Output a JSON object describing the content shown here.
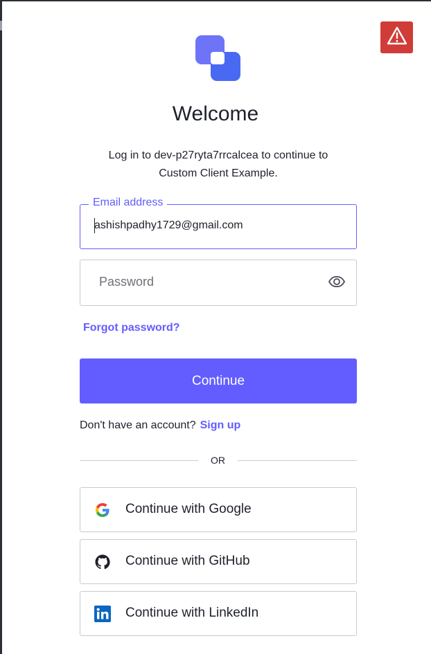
{
  "header": {
    "title": "Welcome",
    "subtitle_line1": "Log in to dev-p27ryta7rrcalcea to continue to",
    "subtitle_line2": "Custom Client Example."
  },
  "form": {
    "email": {
      "label": "Email address",
      "value": "ashishpadhy1729@gmail.com"
    },
    "password": {
      "placeholder": "Password",
      "value": ""
    },
    "forgot_password": "Forgot password?",
    "continue_label": "Continue"
  },
  "signup": {
    "prompt": "Don't have an account?",
    "link": "Sign up"
  },
  "divider": "OR",
  "social": [
    {
      "label": "Continue with Google",
      "icon": "google-icon"
    },
    {
      "label": "Continue with GitHub",
      "icon": "github-icon"
    },
    {
      "label": "Continue with LinkedIn",
      "icon": "linkedin-icon"
    }
  ],
  "icons": {
    "alert": "warning-triangle-icon",
    "logo": "brand-logo-icon",
    "password_toggle": "eye-icon"
  },
  "colors": {
    "accent": "#635dff",
    "alert": "#d03c38",
    "text": "#1e212a",
    "border": "#c9cace",
    "logo_back": "#3f59e4",
    "logo_front": "#7683ff"
  }
}
